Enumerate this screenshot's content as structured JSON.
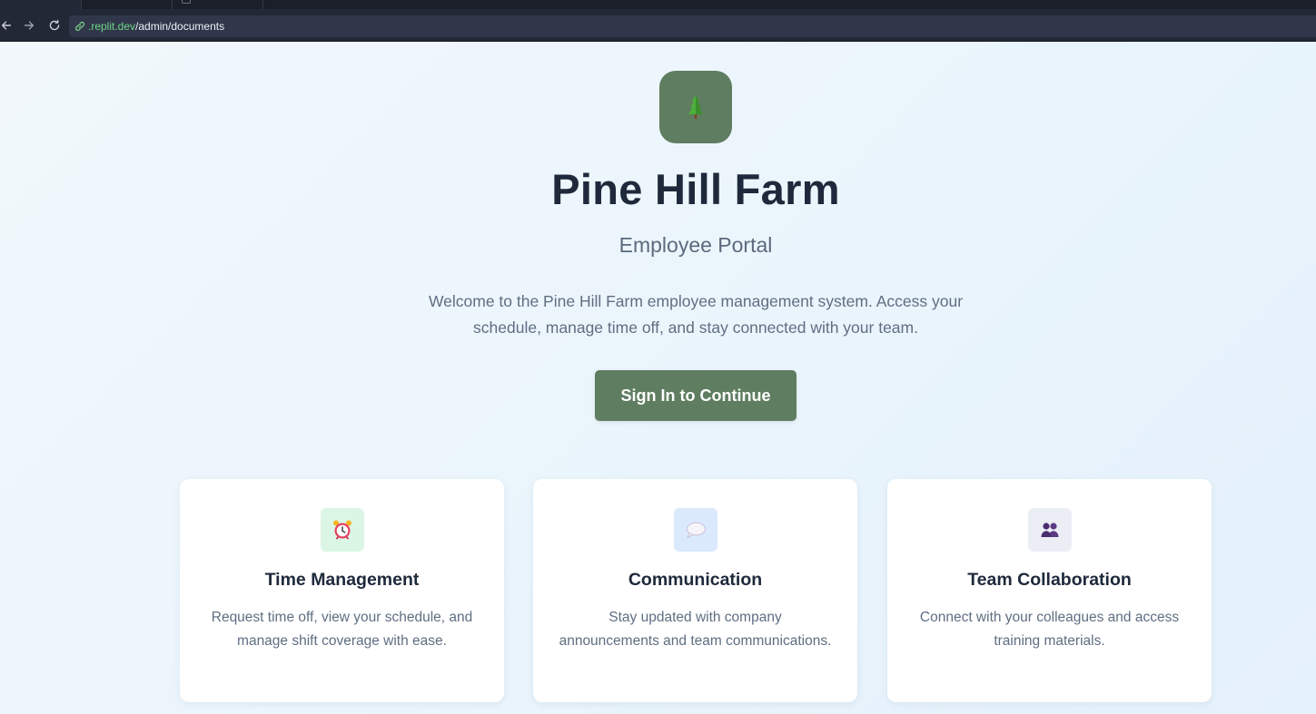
{
  "browser": {
    "url_host": ".replit.dev",
    "url_path": "/admin/documents"
  },
  "hero": {
    "logo_icon": "pine-tree-icon",
    "title": "Pine Hill Farm",
    "subtitle": "Employee Portal",
    "welcome_text": "Welcome to the Pine Hill Farm employee management system. Access your schedule, manage time off, and stay connected with your team.",
    "signin_label": "Sign In to Continue"
  },
  "features": [
    {
      "icon": "alarm-clock-icon",
      "title": "Time Management",
      "description": "Request time off, view your schedule, and manage shift coverage with ease."
    },
    {
      "icon": "speech-bubble-icon",
      "title": "Communication",
      "description": "Stay updated with company announcements and team communications."
    },
    {
      "icon": "people-icon",
      "title": "Team Collaboration",
      "description": "Connect with your colleagues and access training materials."
    }
  ],
  "colors": {
    "brand_green": "#5f7d61",
    "heading": "#1e293b",
    "body_text": "#5f6e82",
    "browser_chrome": "#232837",
    "url_host": "#6fd686"
  }
}
